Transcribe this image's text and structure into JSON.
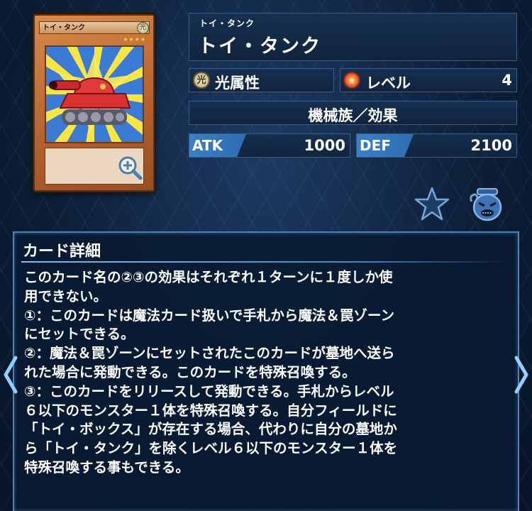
{
  "card": {
    "name_ruby": "トイ・タンク",
    "name": "トイ・タンク",
    "mini_title": "トイ・タンク",
    "mini_stars": "★★★★",
    "mini_attribute": "光"
  },
  "stats": {
    "attribute_glyph": "光",
    "attribute_label": "光属性",
    "level_label": "レベル",
    "level_value": "4",
    "type_line": "機械族／効果",
    "atk_label": "ATK",
    "atk_value": "1000",
    "def_label": "DEF",
    "def_value": "2100"
  },
  "details": {
    "title": "カード詳細",
    "lines": [
      "このカード名の②③の効果はそれぞれ１ターンに１度しか使",
      "用できない。",
      "①：このカードは魔法カード扱いで手札から魔法＆罠ゾーン",
      "にセットできる。",
      "②：魔法＆罠ゾーンにセットされたこのカードが墓地へ送ら",
      "れた場合に発動できる。このカードを特殊召喚する。",
      "③：このカードをリリースして発動できる。手札からレベル",
      "６以下のモンスター１体を特殊召喚する。自分フィールドに",
      "「トイ・ボックス」が存在する場合、代わりに自分の墓地か",
      "ら「トイ・タンク」を除くレベル６以下のモンスター１体を",
      "特殊召喚する事もできる。"
    ]
  },
  "icons": {
    "zoom": "zoom-in-icon",
    "favorite": "star-icon",
    "deck": "pot-icon",
    "prev": "chevron-left-icon",
    "next": "chevron-right-icon"
  },
  "colors": {
    "panel_border": "#3a5c85",
    "accent_blue": "#3d7fc6",
    "background": "#0c1d35"
  }
}
